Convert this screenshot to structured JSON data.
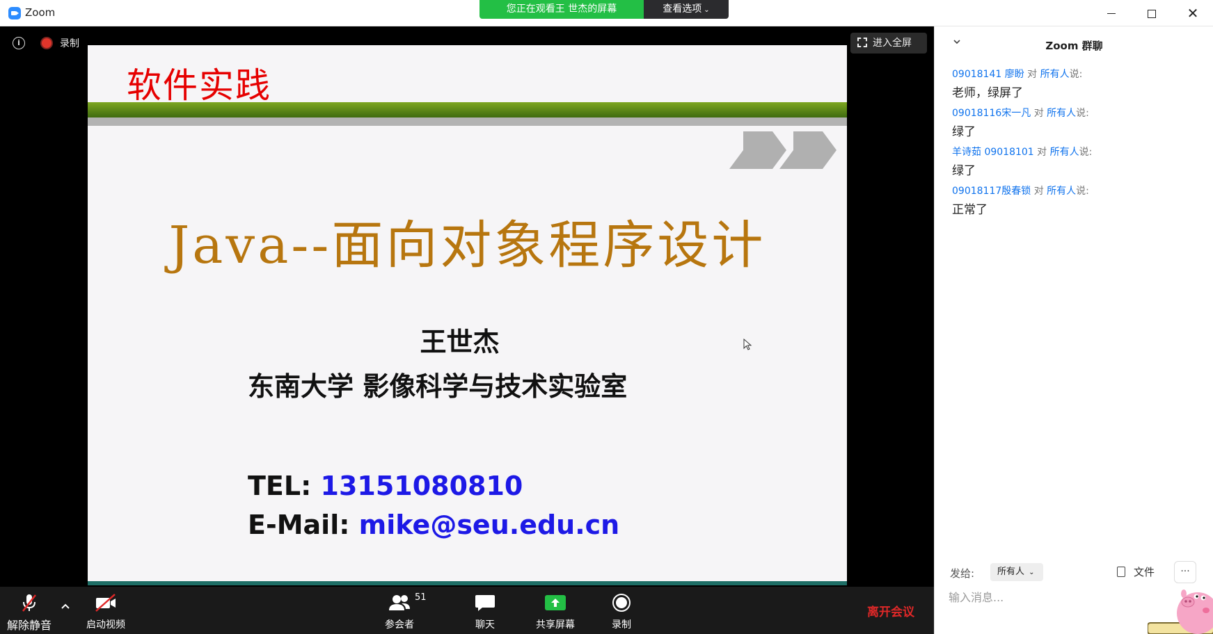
{
  "window": {
    "app_title": "Zoom",
    "share_banner": "您正在观看王 世杰的屏幕",
    "view_options": "查看选项",
    "minimize": "—",
    "maximize": "☐",
    "close": "✕"
  },
  "meeting": {
    "info": "i",
    "record_status": "录制",
    "fullscreen": "进入全屏"
  },
  "slide": {
    "course_title": "软件实践",
    "main_title": "Java--面向对象程序设计",
    "author": "王世杰",
    "affiliation": "东南大学  影像科学与技术实验室",
    "tel_label": "TEL:  ",
    "tel_value": "13151080810",
    "email_label": "E-Mail: ",
    "email_value": "mike@seu.edu.cn"
  },
  "toolbar": {
    "unmute": "解除静音",
    "start_video": "启动视频",
    "participants": "参会者",
    "participants_count": "51",
    "chat": "聊天",
    "share_screen": "共享屏幕",
    "record": "录制",
    "leave": "离开会议"
  },
  "chat": {
    "title": "Zoom 群聊",
    "to_word": " 对 ",
    "everyone": "所有人",
    "says": "说:",
    "messages": [
      {
        "sender": "09018141 廖盼",
        "text": "老师，绿屏了"
      },
      {
        "sender": "09018116宋一凡",
        "text": "绿了"
      },
      {
        "sender": "羊诗茹 09018101",
        "text": "绿了"
      },
      {
        "sender": "09018117殷春锁",
        "text": "正常了"
      }
    ],
    "send_to_label": "发给:",
    "send_to_value": "所有人",
    "file_label": "文件",
    "more": "···",
    "input_placeholder": "输入消息..."
  },
  "colors": {
    "share_banner": "#23bf45",
    "link_blue": "#0e72ed",
    "leave_red": "#e02828",
    "slide_title_red": "#e60000",
    "slide_title_gold": "#b7760f",
    "slide_band_green": "#5a8a18",
    "contact_blue": "#1d19e6"
  }
}
